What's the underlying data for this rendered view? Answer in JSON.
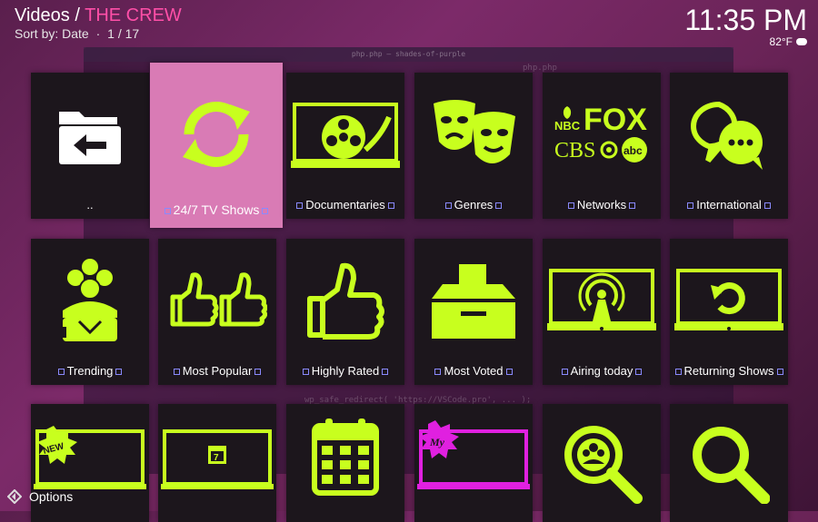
{
  "header": {
    "section": "Videos",
    "separator": "/",
    "addon": "THE CREW",
    "sort_label": "Sort by: Date",
    "dot": "·",
    "page": "1 / 17"
  },
  "clock": "11:35 PM",
  "weather": {
    "temp": "82°F",
    "icon": "cloud-icon"
  },
  "background": {
    "window_title": "php.php — shades-of-purple",
    "tab": "php.php",
    "code_lines": [
      "wp_safe_redirect( 'https://VSCode.pro', ... );"
    ]
  },
  "tiles": [
    {
      "label": "..",
      "icon": "back-folder-icon"
    },
    {
      "label": "24/7 TV Shows",
      "icon": "refresh-icon"
    },
    {
      "label": "Documentaries",
      "icon": "film-reel-icon"
    },
    {
      "label": "Genres",
      "icon": "theater-masks-icon"
    },
    {
      "label": "Networks",
      "icon": "network-logos-icon",
      "logos": [
        "NBC",
        "FOX",
        "CBS",
        "abc"
      ]
    },
    {
      "label": "International",
      "icon": "chat-bubbles-icon"
    },
    {
      "label": "Trending",
      "icon": "crowd-icon"
    },
    {
      "label": "Most Popular",
      "icon": "two-thumbs-up-icon"
    },
    {
      "label": "Highly Rated",
      "icon": "thumb-up-icon"
    },
    {
      "label": "Most Voted",
      "icon": "ballot-box-icon"
    },
    {
      "label": "Airing today",
      "icon": "broadcast-tv-icon"
    },
    {
      "label": "Returning Shows",
      "icon": "replay-tv-icon"
    },
    {
      "label": "",
      "icon": "new-tv-icon",
      "badge": "NEW"
    },
    {
      "label": "",
      "icon": "calendar-tv-icon",
      "day": "7"
    },
    {
      "label": "",
      "icon": "calendar-icon"
    },
    {
      "label": "",
      "icon": "my-tv-icon",
      "badge": "My"
    },
    {
      "label": "",
      "icon": "search-people-icon"
    },
    {
      "label": "",
      "icon": "search-icon"
    }
  ],
  "options_label": "Options",
  "colors": {
    "accent": "#c8ff1e",
    "focus_bg": "#d97bb5",
    "tile_bg": "#1c161c",
    "addon_title": "#ff4fa8",
    "magenta": "#e020e0"
  }
}
